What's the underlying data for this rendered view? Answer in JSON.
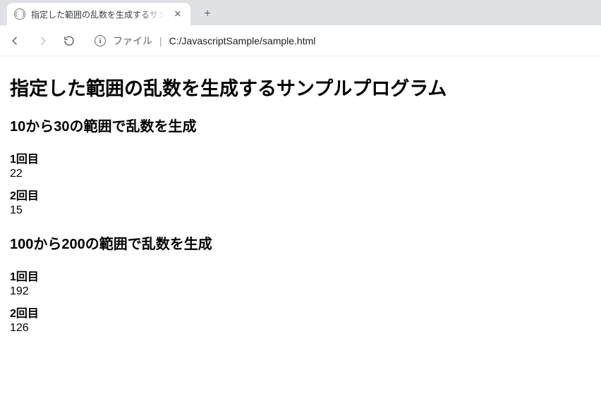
{
  "browser": {
    "tab_title": "指定した範囲の乱数を生成するサンプ",
    "url_scheme_label": "ファイル",
    "url_path": "C:/JavascriptSample/sample.html"
  },
  "page": {
    "title": "指定した範囲の乱数を生成するサンプルプログラム",
    "sections": [
      {
        "heading": "10から30の範囲で乱数を生成",
        "trials": [
          {
            "label": "1回目",
            "value": "22"
          },
          {
            "label": "2回目",
            "value": "15"
          }
        ]
      },
      {
        "heading": "100から200の範囲で乱数を生成",
        "trials": [
          {
            "label": "1回目",
            "value": "192"
          },
          {
            "label": "2回目",
            "value": "126"
          }
        ]
      }
    ]
  }
}
